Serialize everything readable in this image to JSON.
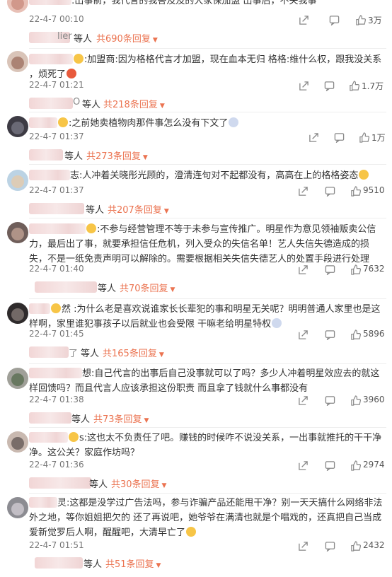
{
  "comments": [
    {
      "text": ":出事前，我代言的我答及及的大家保加盟 出事后，不关我事",
      "time": "22-4-7 00:10",
      "likes": "3万",
      "reply_name": "lier",
      "reply_who": "等人",
      "reply_more": "共690条回复"
    },
    {
      "text": ":加盟商:因为格格代言才加盟，现在血本无归 格格:维什么权，跟我没关系 ，烦死了",
      "time": "22-4-7 01:21",
      "likes": "1.7万",
      "reply_name": "O",
      "reply_who": "等人",
      "reply_more": "共218条回复"
    },
    {
      "text": ":之前她卖植物肉那件事怎么没有下文了",
      "time": "22-4-7 01:37",
      "likes": "1万",
      "reply_name": "",
      "reply_who": "等人",
      "reply_more": "共273条回复"
    },
    {
      "text": "志:人冲着关晓彤光顾的，澄清连句对不起都没有，高高在上的格格姿态",
      "time": "22-4-7 01:37",
      "likes": "9510",
      "reply_name": "",
      "reply_who": "等人",
      "reply_more": "共207条回复"
    },
    {
      "text": ":不参与经营管理不等于未参与宣传推广。明星作为意见领袖贩卖公信力，最后出了事，就要承担信任危机，列入受众的失信名单！艺人失信失德造成的损失，不是一纸免责声明可以解除的。需要根据相关失信失德艺人的处置手段进行处理",
      "time": "22-4-7 01:40",
      "likes": "7632",
      "reply_name": "",
      "reply_who": "等人",
      "reply_more": "共70条回复"
    },
    {
      "text": "然 :为什么老是喜欢说谁家长长辈犯的事和明星无关呢？明明普通人家里也是这样啊，家里谁犯事孩子以后就业也会受限 干嘛老给明星特权",
      "time": "22-4-7 01:45",
      "likes": "5896",
      "reply_name": "了",
      "reply_who": "等人",
      "reply_more": "共165条回复"
    },
    {
      "text": "想:自己代言的出事后自己没事就可以了吗？多少人冲着明星效应去的就这样回馈吗？而且代言人应该承担这份职责 而且拿了钱就什么事都没有",
      "time": "22-4-7 01:38",
      "likes": "3960",
      "reply_name": "",
      "reply_who": "等人",
      "reply_more": "共73条回复"
    },
    {
      "text": "s:这也太不负责任了吧。赚钱的时候咋不说没关系，一出事就推托的干干净净。这公关？家庭作坊吗？",
      "time": "22-4-7 01:36",
      "likes": "2974",
      "reply_name": "",
      "reply_who": "等人",
      "reply_more": "共30条回复"
    },
    {
      "text": "灵:这都是没学过广告法吗，参与诈骗产品还能甩干净？别一天天搞什么网络非法外之地，等你姐姐把欠的 还了再说吧，她爷爷在满清也就是个唱戏的，还真把自己当成爱新觉罗后人啊，醒醒吧，大清早亡了",
      "time": "22-4-7 01:51",
      "likes": "2432",
      "reply_name": "",
      "reply_who": "等人",
      "reply_more": "共51条回复"
    }
  ],
  "colors": {
    "accent": "#eb7350",
    "meta": "#777777",
    "text": "#333333"
  },
  "icons": {
    "share": "share-icon",
    "comment": "comment-icon",
    "like": "like-icon"
  }
}
